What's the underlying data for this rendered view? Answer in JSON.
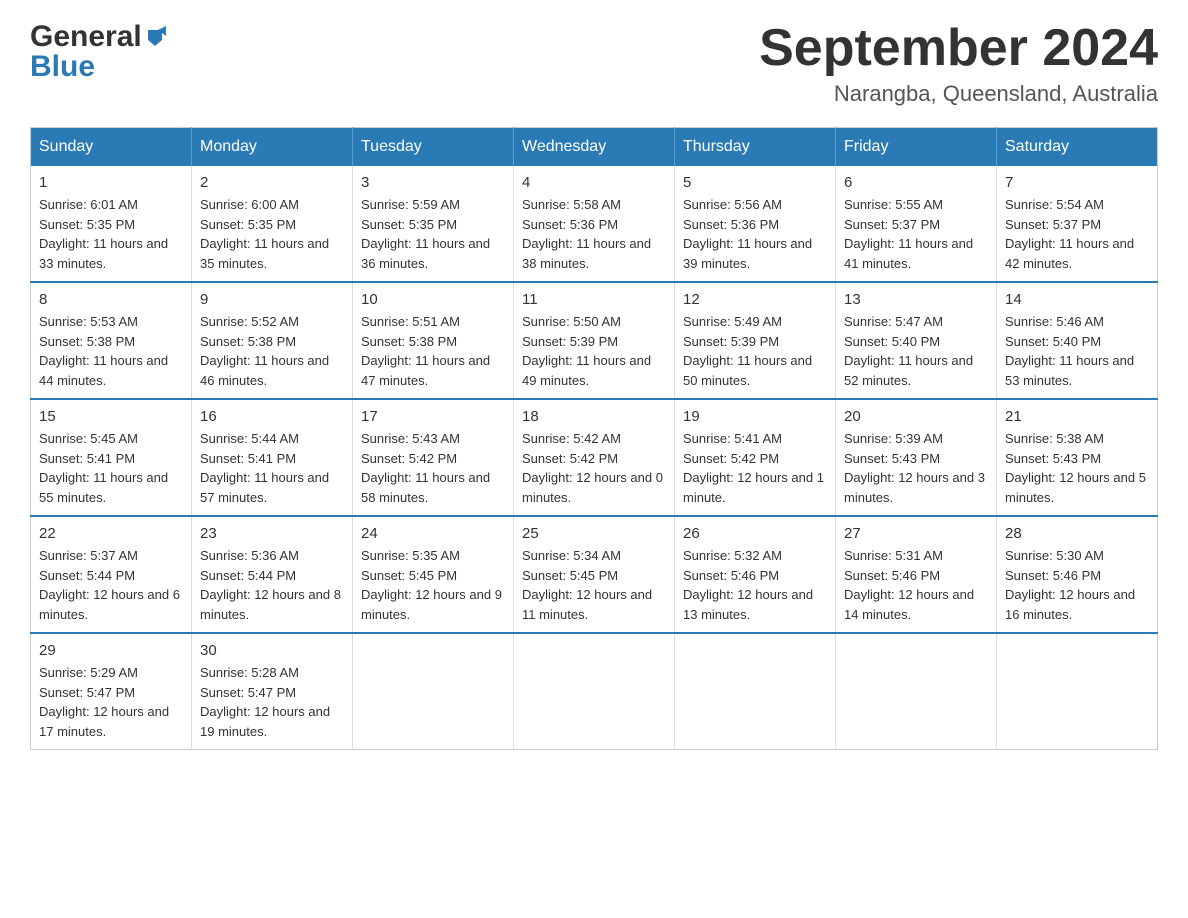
{
  "header": {
    "logo_line1": "General",
    "logo_line2": "Blue",
    "month_title": "September 2024",
    "location": "Narangba, Queensland, Australia"
  },
  "weekdays": [
    "Sunday",
    "Monday",
    "Tuesday",
    "Wednesday",
    "Thursday",
    "Friday",
    "Saturday"
  ],
  "weeks": [
    [
      {
        "day": "1",
        "sunrise": "Sunrise: 6:01 AM",
        "sunset": "Sunset: 5:35 PM",
        "daylight": "Daylight: 11 hours and 33 minutes."
      },
      {
        "day": "2",
        "sunrise": "Sunrise: 6:00 AM",
        "sunset": "Sunset: 5:35 PM",
        "daylight": "Daylight: 11 hours and 35 minutes."
      },
      {
        "day": "3",
        "sunrise": "Sunrise: 5:59 AM",
        "sunset": "Sunset: 5:35 PM",
        "daylight": "Daylight: 11 hours and 36 minutes."
      },
      {
        "day": "4",
        "sunrise": "Sunrise: 5:58 AM",
        "sunset": "Sunset: 5:36 PM",
        "daylight": "Daylight: 11 hours and 38 minutes."
      },
      {
        "day": "5",
        "sunrise": "Sunrise: 5:56 AM",
        "sunset": "Sunset: 5:36 PM",
        "daylight": "Daylight: 11 hours and 39 minutes."
      },
      {
        "day": "6",
        "sunrise": "Sunrise: 5:55 AM",
        "sunset": "Sunset: 5:37 PM",
        "daylight": "Daylight: 11 hours and 41 minutes."
      },
      {
        "day": "7",
        "sunrise": "Sunrise: 5:54 AM",
        "sunset": "Sunset: 5:37 PM",
        "daylight": "Daylight: 11 hours and 42 minutes."
      }
    ],
    [
      {
        "day": "8",
        "sunrise": "Sunrise: 5:53 AM",
        "sunset": "Sunset: 5:38 PM",
        "daylight": "Daylight: 11 hours and 44 minutes."
      },
      {
        "day": "9",
        "sunrise": "Sunrise: 5:52 AM",
        "sunset": "Sunset: 5:38 PM",
        "daylight": "Daylight: 11 hours and 46 minutes."
      },
      {
        "day": "10",
        "sunrise": "Sunrise: 5:51 AM",
        "sunset": "Sunset: 5:38 PM",
        "daylight": "Daylight: 11 hours and 47 minutes."
      },
      {
        "day": "11",
        "sunrise": "Sunrise: 5:50 AM",
        "sunset": "Sunset: 5:39 PM",
        "daylight": "Daylight: 11 hours and 49 minutes."
      },
      {
        "day": "12",
        "sunrise": "Sunrise: 5:49 AM",
        "sunset": "Sunset: 5:39 PM",
        "daylight": "Daylight: 11 hours and 50 minutes."
      },
      {
        "day": "13",
        "sunrise": "Sunrise: 5:47 AM",
        "sunset": "Sunset: 5:40 PM",
        "daylight": "Daylight: 11 hours and 52 minutes."
      },
      {
        "day": "14",
        "sunrise": "Sunrise: 5:46 AM",
        "sunset": "Sunset: 5:40 PM",
        "daylight": "Daylight: 11 hours and 53 minutes."
      }
    ],
    [
      {
        "day": "15",
        "sunrise": "Sunrise: 5:45 AM",
        "sunset": "Sunset: 5:41 PM",
        "daylight": "Daylight: 11 hours and 55 minutes."
      },
      {
        "day": "16",
        "sunrise": "Sunrise: 5:44 AM",
        "sunset": "Sunset: 5:41 PM",
        "daylight": "Daylight: 11 hours and 57 minutes."
      },
      {
        "day": "17",
        "sunrise": "Sunrise: 5:43 AM",
        "sunset": "Sunset: 5:42 PM",
        "daylight": "Daylight: 11 hours and 58 minutes."
      },
      {
        "day": "18",
        "sunrise": "Sunrise: 5:42 AM",
        "sunset": "Sunset: 5:42 PM",
        "daylight": "Daylight: 12 hours and 0 minutes."
      },
      {
        "day": "19",
        "sunrise": "Sunrise: 5:41 AM",
        "sunset": "Sunset: 5:42 PM",
        "daylight": "Daylight: 12 hours and 1 minute."
      },
      {
        "day": "20",
        "sunrise": "Sunrise: 5:39 AM",
        "sunset": "Sunset: 5:43 PM",
        "daylight": "Daylight: 12 hours and 3 minutes."
      },
      {
        "day": "21",
        "sunrise": "Sunrise: 5:38 AM",
        "sunset": "Sunset: 5:43 PM",
        "daylight": "Daylight: 12 hours and 5 minutes."
      }
    ],
    [
      {
        "day": "22",
        "sunrise": "Sunrise: 5:37 AM",
        "sunset": "Sunset: 5:44 PM",
        "daylight": "Daylight: 12 hours and 6 minutes."
      },
      {
        "day": "23",
        "sunrise": "Sunrise: 5:36 AM",
        "sunset": "Sunset: 5:44 PM",
        "daylight": "Daylight: 12 hours and 8 minutes."
      },
      {
        "day": "24",
        "sunrise": "Sunrise: 5:35 AM",
        "sunset": "Sunset: 5:45 PM",
        "daylight": "Daylight: 12 hours and 9 minutes."
      },
      {
        "day": "25",
        "sunrise": "Sunrise: 5:34 AM",
        "sunset": "Sunset: 5:45 PM",
        "daylight": "Daylight: 12 hours and 11 minutes."
      },
      {
        "day": "26",
        "sunrise": "Sunrise: 5:32 AM",
        "sunset": "Sunset: 5:46 PM",
        "daylight": "Daylight: 12 hours and 13 minutes."
      },
      {
        "day": "27",
        "sunrise": "Sunrise: 5:31 AM",
        "sunset": "Sunset: 5:46 PM",
        "daylight": "Daylight: 12 hours and 14 minutes."
      },
      {
        "day": "28",
        "sunrise": "Sunrise: 5:30 AM",
        "sunset": "Sunset: 5:46 PM",
        "daylight": "Daylight: 12 hours and 16 minutes."
      }
    ],
    [
      {
        "day": "29",
        "sunrise": "Sunrise: 5:29 AM",
        "sunset": "Sunset: 5:47 PM",
        "daylight": "Daylight: 12 hours and 17 minutes."
      },
      {
        "day": "30",
        "sunrise": "Sunrise: 5:28 AM",
        "sunset": "Sunset: 5:47 PM",
        "daylight": "Daylight: 12 hours and 19 minutes."
      },
      {
        "day": "",
        "sunrise": "",
        "sunset": "",
        "daylight": ""
      },
      {
        "day": "",
        "sunrise": "",
        "sunset": "",
        "daylight": ""
      },
      {
        "day": "",
        "sunrise": "",
        "sunset": "",
        "daylight": ""
      },
      {
        "day": "",
        "sunrise": "",
        "sunset": "",
        "daylight": ""
      },
      {
        "day": "",
        "sunrise": "",
        "sunset": "",
        "daylight": ""
      }
    ]
  ]
}
